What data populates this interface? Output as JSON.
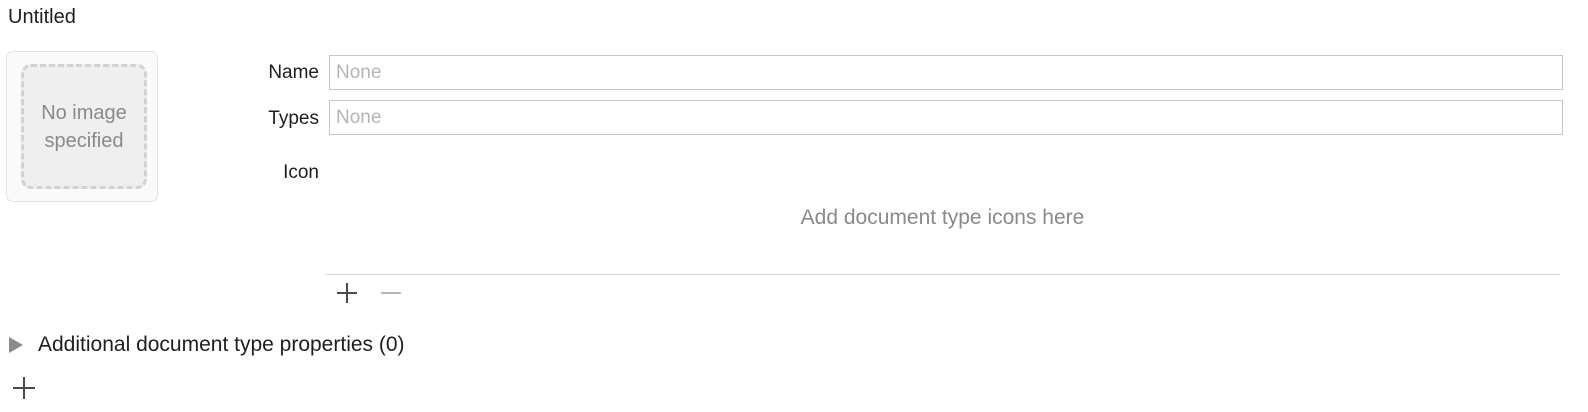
{
  "section": {
    "title": "Untitled"
  },
  "image_well": {
    "placeholder": "No image specified"
  },
  "fields": {
    "name": {
      "label": "Name",
      "value": "",
      "placeholder": "None"
    },
    "types": {
      "label": "Types",
      "value": "",
      "placeholder": "None"
    },
    "icon": {
      "label": "Icon",
      "hint": "Add document type icons here"
    }
  },
  "icon_buttons": {
    "add": "plus-icon",
    "remove": "minus-icon"
  },
  "additional": {
    "label": "Additional document type properties (0)",
    "expanded": false
  },
  "footer": {
    "add_icon": "plus-icon"
  },
  "colors": {
    "text": "#1e1e1e",
    "secondary": "#8a8a8a",
    "placeholder": "#b5b5b5",
    "border": "#c8c8c8",
    "disabled": "#b8b8b8"
  }
}
